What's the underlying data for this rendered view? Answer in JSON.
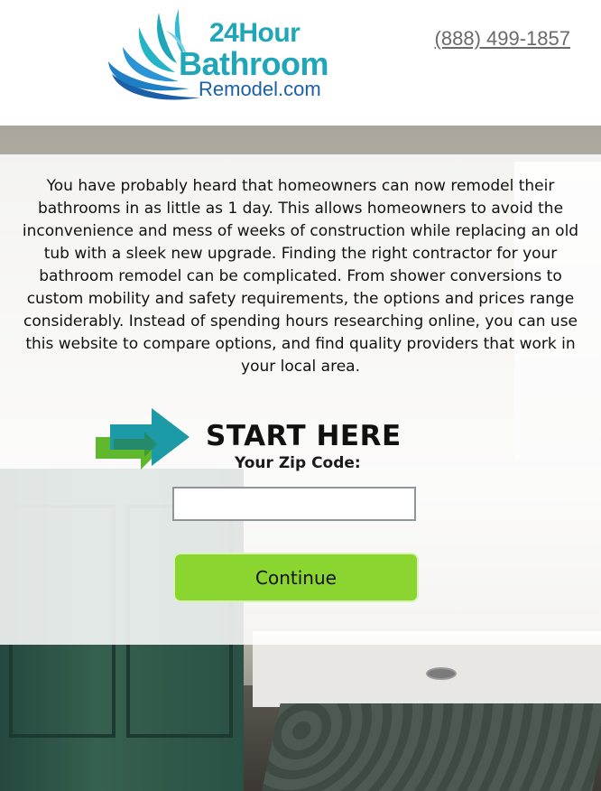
{
  "header": {
    "logo": {
      "line1": "24Hour",
      "line2": "Bathroom",
      "line3": "Remodel.com"
    },
    "phone": "(888) 499-1857"
  },
  "main": {
    "intro": "You have probably heard that homeowners can now remodel their bathrooms in as little as 1 day. This allows homeowners to avoid the inconvenience and mess of weeks of construction while replacing an old tub with a sleek new upgrade. Finding the right contractor for your bathroom remodel can be complicated. From shower conversions to custom mobility and safety requirements, the options and prices range considerably. Instead of spending hours researching online, you can use this website to compare options, and find quality providers that work in your local area.",
    "start_here": "START HERE",
    "zip_label": "Your Zip Code:",
    "zip_value": "",
    "continue_label": "Continue"
  },
  "colors": {
    "brand_teal": "#1fa6b8",
    "brand_blue": "#1b5fa6",
    "button_green": "#8ad52f",
    "arrow_green": "#5fb82e",
    "arrow_teal": "#1c9aa6"
  },
  "icons": [
    "logo-splash-icon",
    "start-arrows-icon"
  ]
}
